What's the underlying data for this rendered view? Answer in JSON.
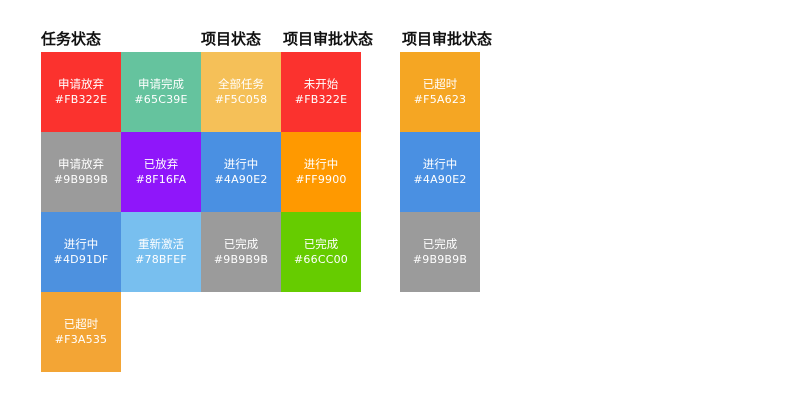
{
  "headings": {
    "task_status": "任务状态",
    "project_status": "项目状态",
    "project_approval_status_1": "项目审批状态",
    "project_approval_status_2": "项目审批状态"
  },
  "swatches": {
    "c1r1": {
      "label": "申请放弃",
      "hex": "#FB322E",
      "color": "#FB322E"
    },
    "c1r2": {
      "label": "申请放弃",
      "hex": "#9B9B9B",
      "color": "#9B9B9B"
    },
    "c1r3": {
      "label": "进行中",
      "hex": "#4D91DF",
      "color": "#4D91DF"
    },
    "c1r4": {
      "label": "已超时",
      "hex": "#F3A535",
      "color": "#F3A535"
    },
    "c2r1": {
      "label": "申请完成",
      "hex": "#65C39E",
      "color": "#65C39E"
    },
    "c2r2": {
      "label": "已放弃",
      "hex": "#8F16FA",
      "color": "#8F16FA"
    },
    "c2r3": {
      "label": "重新激活",
      "hex": "#78BFEF",
      "color": "#78BFEF"
    },
    "c3r1": {
      "label": "全部任务",
      "hex": "#F5C058",
      "color": "#F5C058"
    },
    "c3r2": {
      "label": "进行中",
      "hex": "#4A90E2",
      "color": "#4A90E2"
    },
    "c3r3": {
      "label": "已完成",
      "hex": "#9B9B9B",
      "color": "#9B9B9B"
    },
    "c4r1": {
      "label": "未开始",
      "hex": "#FB322E",
      "color": "#FB322E"
    },
    "c4r2": {
      "label": "进行中",
      "hex": "#FF9900",
      "color": "#FF9900"
    },
    "c4r3": {
      "label": "已完成",
      "hex": "#66CC00",
      "color": "#66CC00"
    },
    "c5r1": {
      "label": "已超时",
      "hex": "#F5A623",
      "color": "#F5A623"
    },
    "c5r2": {
      "label": "进行中",
      "hex": "#4A90E2",
      "color": "#4A90E2"
    },
    "c5r3": {
      "label": "已完成",
      "hex": "#9B9B9B",
      "color": "#9B9B9B"
    }
  }
}
